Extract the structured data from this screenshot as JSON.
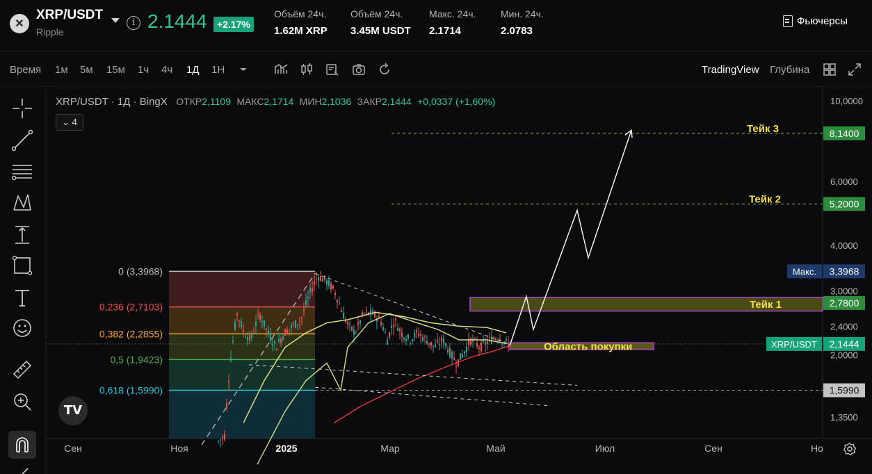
{
  "header": {
    "pair": "XRP/USDT",
    "asset_name": "Ripple",
    "last_price": "2.1444",
    "change": "+2.17%",
    "stats": [
      {
        "label": "Объём 24ч.",
        "value": "1.62M XRP"
      },
      {
        "label": "Объём 24ч.",
        "value": "3.45M USDT"
      },
      {
        "label": "Макс. 24ч.",
        "value": "2.1714"
      },
      {
        "label": "Мин. 24ч.",
        "value": "2.0783"
      }
    ],
    "futures_label": "Фьючерсы"
  },
  "toolbar": {
    "timeframes": [
      "Время",
      "1м",
      "5м",
      "15м",
      "1ч",
      "4ч",
      "1Д",
      "1Н"
    ],
    "active_timeframe": "1Д",
    "tradingview_label": "TradingView",
    "depth_label": "Глубина"
  },
  "legend": {
    "title": "XRP/USDT · 1Д · BingX",
    "open_label": "ОТКР",
    "open": "2,1109",
    "high_label": "МАКС",
    "high": "2,1714",
    "low_label": "МИН",
    "low": "2,1036",
    "close_label": "ЗАКР",
    "close": "2,1444",
    "change": "+0,0337 (+1,60%)",
    "indicators_count": "4"
  },
  "chart_data": {
    "type": "candlestick",
    "scale": "log",
    "y_ticks": [
      "10,0000",
      "6,0000",
      "4,0000",
      "3,0000",
      "2,4000",
      "2,0000",
      "1,3500"
    ],
    "x_ticks": [
      "Сен",
      "Ноя",
      "2025",
      "Мар",
      "Май",
      "Июл",
      "Сен",
      "Но"
    ],
    "fib_levels": [
      {
        "ratio": "0",
        "value": "3,3968",
        "label": "0 (3,3968)",
        "color": "#bdbdbd"
      },
      {
        "ratio": "0.236",
        "value": "2,7103",
        "label": "0,236 (2,7103)",
        "color": "#f05050"
      },
      {
        "ratio": "0.382",
        "value": "2,2855",
        "label": "0,382 (2,2855)",
        "color": "#f5a623"
      },
      {
        "ratio": "0.5",
        "value": "1,9423",
        "label": "0,5 (1,9423)",
        "color": "#4caf50"
      },
      {
        "ratio": "0.618",
        "value": "1,5990",
        "label": "0,618 (1,5990)",
        "color": "#26c6da"
      }
    ],
    "price_tags": [
      {
        "text": "8,1400",
        "kind": "green"
      },
      {
        "text": "5,2000",
        "kind": "green"
      },
      {
        "text": "3,3968",
        "kind": "max",
        "prefix": "Макс."
      },
      {
        "text": "2,7800",
        "kind": "green"
      },
      {
        "text": "2,1444",
        "kind": "current",
        "prefix": "XRP/USDT"
      },
      {
        "text": "1,5990",
        "kind": "grey"
      }
    ],
    "annotations": {
      "take1": "Тейк 1",
      "take2": "Тейк 2",
      "take3": "Тейк 3",
      "buy_zone": "Область покупки"
    }
  },
  "icons": {
    "close": "close-icon",
    "info": "info-icon",
    "tv": "TV"
  }
}
